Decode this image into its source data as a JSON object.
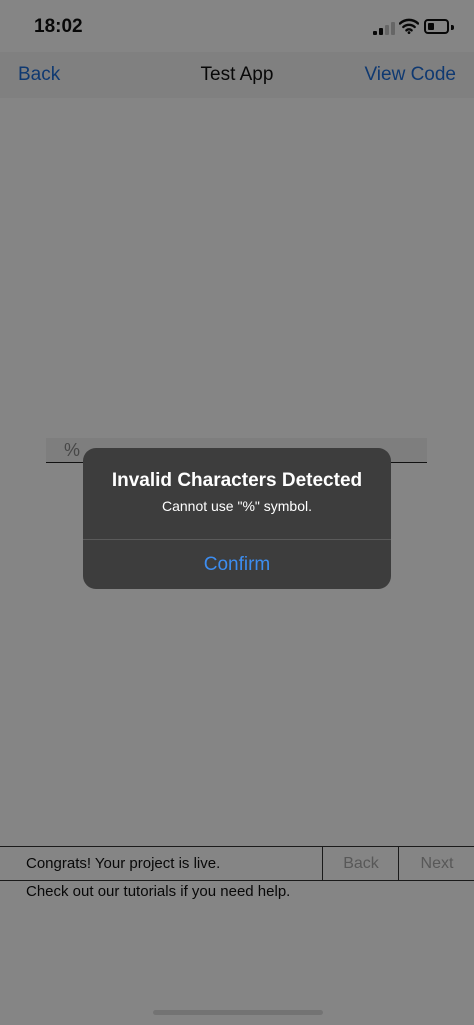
{
  "status_bar": {
    "time": "18:02",
    "battery_level": 0.35
  },
  "nav": {
    "back_label": "Back",
    "title": "Test App",
    "right_label": "View Code",
    "tint_color": "#1e6dd8"
  },
  "text_field": {
    "value": "%"
  },
  "alert": {
    "title": "Invalid Characters Detected",
    "message": "Cannot use \"%\" symbol.",
    "confirm_label": "Confirm",
    "button_color": "#3d8df0"
  },
  "bottom_bar": {
    "message": "Congrats! Your project is live.",
    "back_label": "Back",
    "next_label": "Next",
    "help_text": "Check out our tutorials if you need help."
  }
}
